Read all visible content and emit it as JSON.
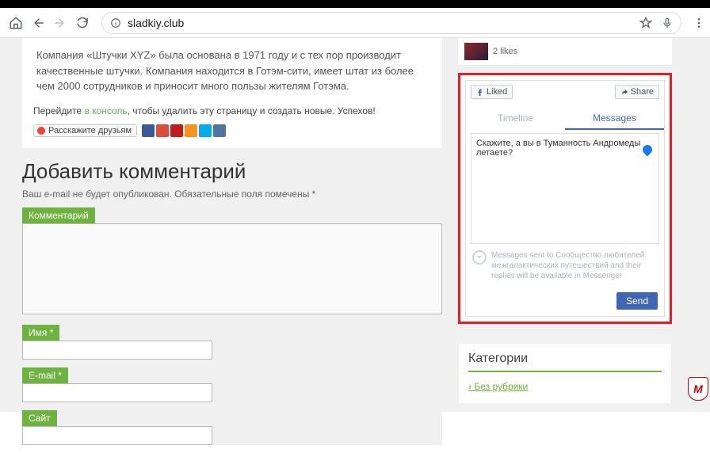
{
  "chrome": {
    "url": "sladkiy.club"
  },
  "article": {
    "body": "Компания «Штучки XYZ» была основана в 1971 году и с тех пор производит качественные штучки. Компания находится в Готэм-сити, имеет штат из более чем 2000 сотрудников и приносит много пользы жителям Готэма."
  },
  "linkline": {
    "before": "Перейдите ",
    "link": "в консоль",
    "after": ", чтобы удалить эту страницу и создать новые. Успехов!"
  },
  "share": {
    "label": "Расскажите друзьям"
  },
  "comments": {
    "title": "Добавить комментарий",
    "note_before": "Ваш e-mail не будет опубликован. Обязательные поля помечены ",
    "star": "*",
    "label_comment": "Комментарий",
    "label_name": "Имя",
    "label_email": "E-mail",
    "label_site": "Сайт"
  },
  "sidebar_top": {
    "likes": "2 likes"
  },
  "fb": {
    "liked": "Liked",
    "share": "Share",
    "tab_timeline": "Timeline",
    "tab_messages": "Messages",
    "placeholder_msg": "Скажите, а вы в Туманность Андромеды летаете?",
    "info": "Messages sent to Сообщество любителей межгалактических путешествий and their replies will be available in Messenger",
    "send": "Send"
  },
  "categories": {
    "title": "Категории",
    "item1": "Без рубрики"
  },
  "badge": {
    "letter": "M"
  }
}
